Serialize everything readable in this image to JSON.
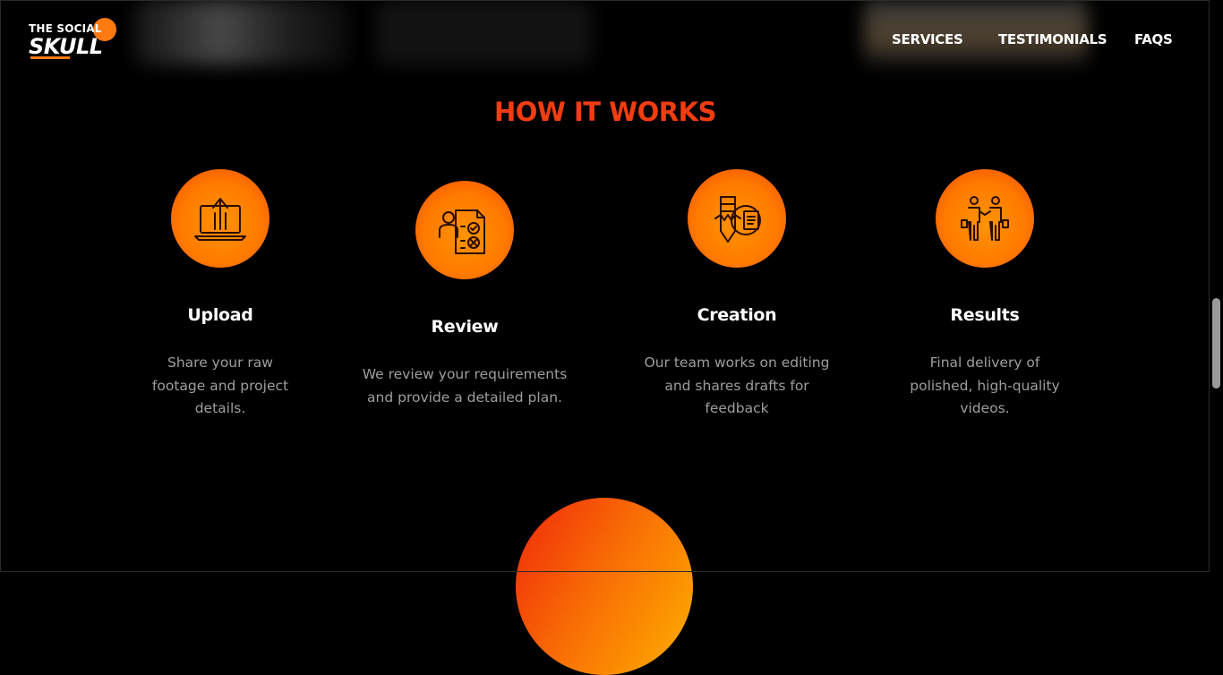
{
  "brand": {
    "line1": "THE SOCIAL",
    "line2": "SKULL",
    "accent": "#ff7a10"
  },
  "nav": {
    "items": [
      {
        "label": "SERVICES"
      },
      {
        "label": "TESTIMONIALS"
      },
      {
        "label": "FAQS"
      }
    ]
  },
  "section": {
    "title": "HOW IT WORKS",
    "title_color": "#f23d10"
  },
  "steps": [
    {
      "icon": "laptop-upload-icon",
      "title": "Upload",
      "text": "Share your raw footage and project details."
    },
    {
      "icon": "review-checklist-icon",
      "title": "Review",
      "text": "We review your requirements and provide a detailed plan."
    },
    {
      "icon": "creative-pencil-gear-icon",
      "title": "Creation",
      "text": "Our team works on editing and shares drafts for feedback"
    },
    {
      "icon": "handshake-people-icon",
      "title": "Results",
      "text": "Final delivery of polished, high-quality videos."
    }
  ],
  "colors": {
    "background": "#000000",
    "circle_orange": "#ff7a00",
    "text_muted": "#9e9e9e"
  }
}
